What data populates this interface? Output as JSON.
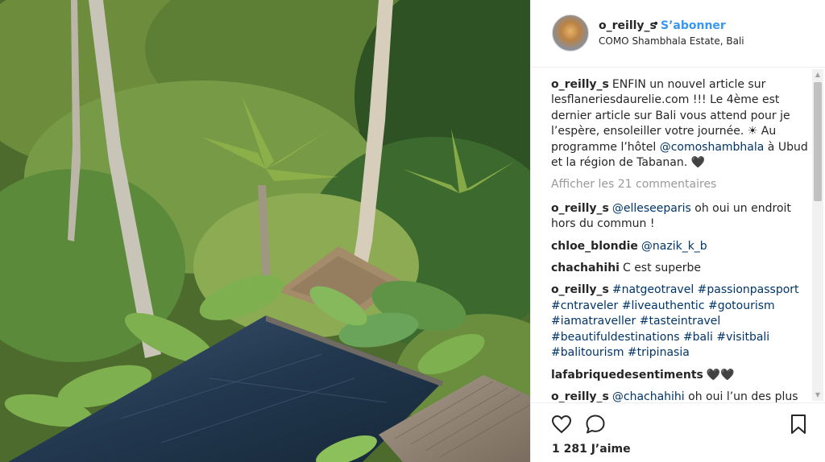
{
  "post": {
    "username": "o_reilly_s",
    "dot": "•",
    "follow_label": "S’abonner",
    "location": "COMO Shambhala Estate, Bali",
    "avatar_icon": "profile-avatar",
    "photo_description_icon": "jungle-infinity-pool-photo"
  },
  "caption": {
    "username": "o_reilly_s",
    "text_a": "ENFIN un nouvel article sur lesflaneriesdaurelie.com !!! Le 4ème est dernier article sur Bali vous attend pour je l’espère, ensoleiller votre journée. ☀ Au programme l’hôtel ",
    "mention": "@comoshambhala",
    "text_b": " à Ubud et la région de Tabanan. 🖤"
  },
  "view_comments": "Afficher les 21 commentaires",
  "comments": [
    {
      "user": "o_reilly_s",
      "mention": "@elleseeparis",
      "text": " oh oui un endroit hors du commun !"
    },
    {
      "user": "chloe_blondie",
      "mention": "@nazik_k_b",
      "text": ""
    },
    {
      "user": "chachahihi",
      "mention": "",
      "text": "C est superbe"
    },
    {
      "user": "o_reilly_s",
      "mention": "#natgeotravel #passionpassport #cntraveler #liveauthentic #gotourism #iamatraveller #tasteintravel #beautifuldestinations #bali #visitbali #balitourism #tripinasia",
      "text": ""
    },
    {
      "user": "lafabriquedesentiments",
      "mention": "",
      "text": "🖤🖤"
    },
    {
      "user": "o_reilly_s",
      "mention": "@chachahihi",
      "text": " oh oui l’un des plus"
    }
  ],
  "likes": "1 281 J’aime",
  "icons": {
    "like": "heart-icon",
    "comment": "comment-bubble-icon",
    "save": "bookmark-icon",
    "scroll_up": "chevron-up-icon",
    "scroll_down": "chevron-down-icon"
  }
}
